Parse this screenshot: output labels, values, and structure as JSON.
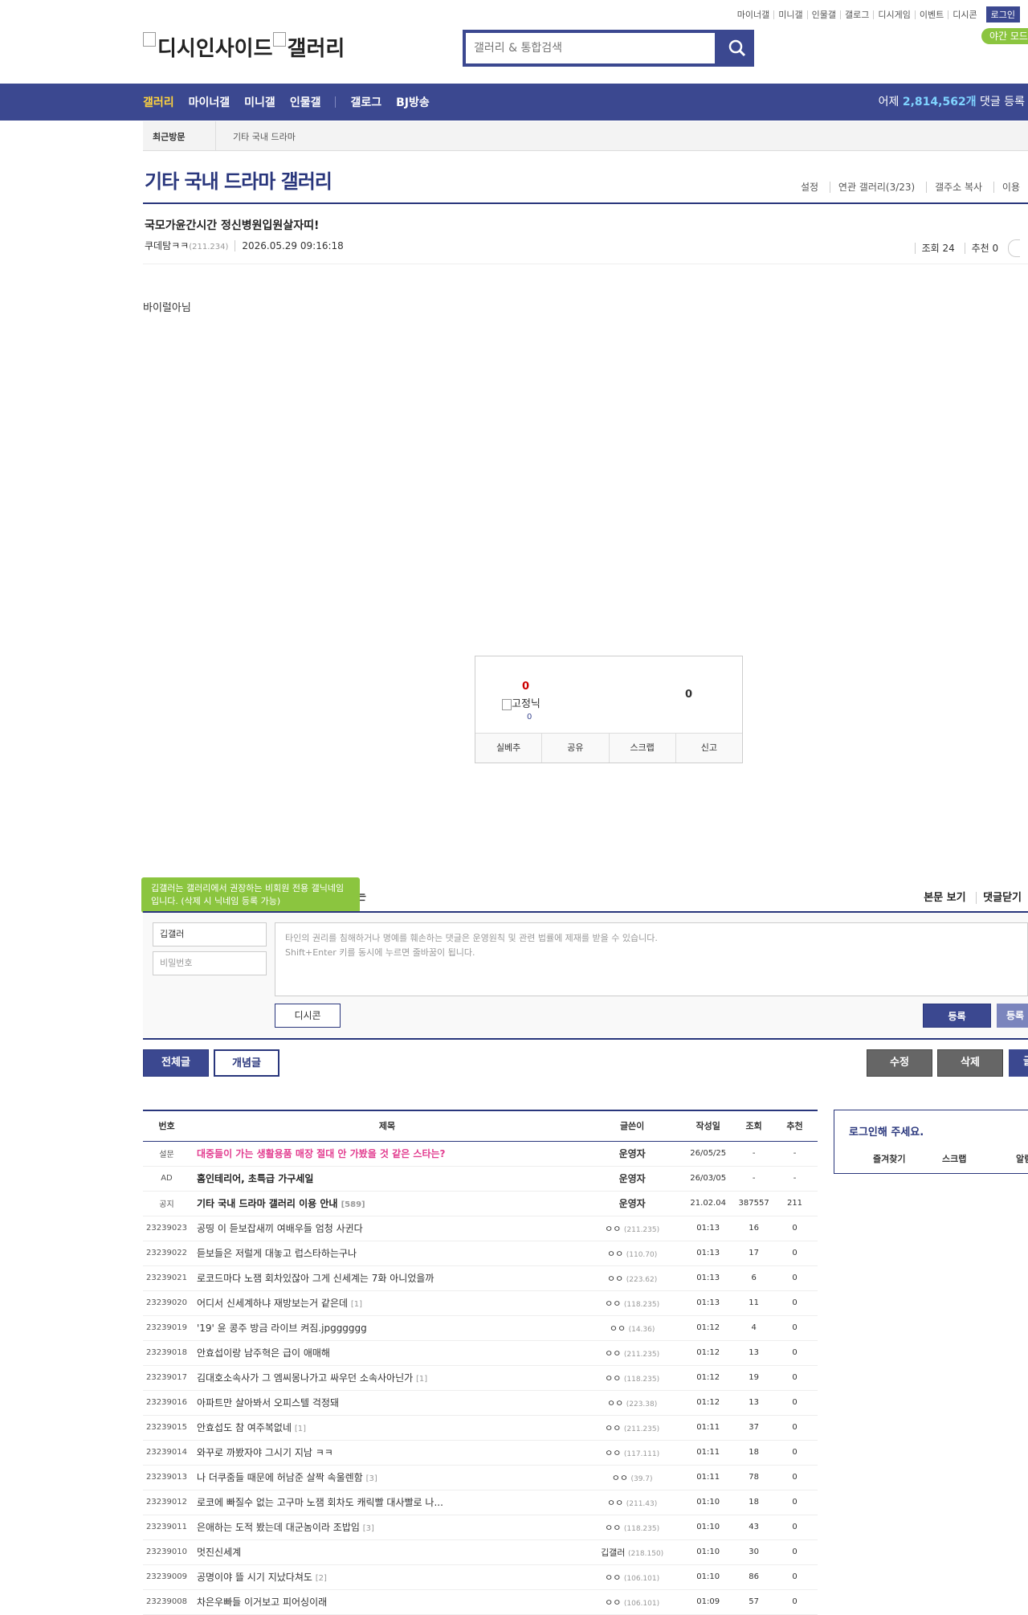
{
  "header": {
    "top_links": [
      "마이너갤",
      "미니갤",
      "인물갤",
      "갤로그",
      "디시게임",
      "이벤트",
      "디시콘"
    ],
    "login_label": "로그인",
    "night_mode_label": "야간 모드",
    "logo_text": "디시인사이드",
    "logo_sub": "갤러리",
    "search_placeholder": "갤러리 & 통합검색"
  },
  "gnb": {
    "menu": [
      "갤러리",
      "마이너갤",
      "미니갤",
      "인물갤",
      "갤로그",
      "BJ방송"
    ],
    "stat_prefix": "어제 ",
    "stat_count": "2,814,562개",
    "stat_suffix": " 댓글 등록"
  },
  "recent": {
    "label": "최근방문",
    "value": "기타 국내 드라마"
  },
  "gallery": {
    "title": "기타 국내 드라마 갤러리",
    "tools": [
      "설정",
      "연관 갤러리(3/23)",
      "갤주소 복사",
      "이용"
    ]
  },
  "post": {
    "title": "국모가윤간시간 정신병원입원살자띠!",
    "writer": "쿠데탐ㅋㅋ",
    "writer_ip": "(211.234)",
    "date": "2026.05.29 09:16:18",
    "views": "조회 24",
    "recommend": "추천 0",
    "body": "바이럴아님"
  },
  "vote": {
    "up_count": "0",
    "fix_label": "고정닉",
    "fix_count": "0",
    "down_count": "0",
    "buttons": [
      "실베추",
      "공유",
      "스크랩",
      "신고"
    ]
  },
  "comment": {
    "tooltip": "깁갤러는 갤러리에서 권장하는 비회원 전용 갤닉네임입니다. (삭제 시 닉네임 등록 가능)",
    "header_tail": "는",
    "right_links": [
      "본문 보기",
      "댓글닫기"
    ],
    "name_value": "깁갤러",
    "pw_placeholder": "비밀번호",
    "text_line1": "타인의 권리를 침해하거나 명예를 훼손하는 댓글은 운영원칙 및 관련 법률에 제재를 받을 수 있습니다.",
    "text_line2": "Shift+Enter 키를 동시에 누르면 줄바꿈이 됩니다.",
    "dccon_label": "디시콘",
    "submit_label": "등록",
    "submit2_label": "등록"
  },
  "list_actions": {
    "tab_all": "전체글",
    "tab_concept": "개념글",
    "edit": "수정",
    "delete": "삭제",
    "write": "글"
  },
  "table": {
    "headers": [
      "번호",
      "제목",
      "글쓴이",
      "작성일",
      "조회",
      "추천"
    ],
    "rows": [
      {
        "num": "설문",
        "title": "대중들이 가는 생활용품 매장 절대 안 가봤을 것 같은 스타는?",
        "cnt": "",
        "writer": "운영자",
        "ip": "",
        "date": "26/05/25",
        "views": "-",
        "rec": "-",
        "style": "hl",
        "admin": true
      },
      {
        "num": "AD",
        "title": "홈인테리어, 초특급 가구세일",
        "cnt": "",
        "writer": "운영자",
        "ip": "",
        "date": "26/03/05",
        "views": "-",
        "rec": "-",
        "style": "bold",
        "admin": true
      },
      {
        "num": "공지",
        "title": "기타 국내 드라마 갤러리 이용 안내",
        "cnt": "[589]",
        "writer": "운영자",
        "ip": "",
        "date": "21.02.04",
        "views": "387557",
        "rec": "211",
        "style": "bold",
        "admin": true
      },
      {
        "num": "23239023",
        "title": "공띵 이 듣보잡새끼 여배우들 엄청 사귄다",
        "cnt": "",
        "writer": "ㅇㅇ",
        "ip": "(211.235)",
        "date": "01:13",
        "views": "16",
        "rec": "0",
        "style": "",
        "admin": false
      },
      {
        "num": "23239022",
        "title": "듣보들은 저럴게 대놓고 럽스타하는구나",
        "cnt": "",
        "writer": "ㅇㅇ",
        "ip": "(110.70)",
        "date": "01:13",
        "views": "17",
        "rec": "0",
        "style": "",
        "admin": false
      },
      {
        "num": "23239021",
        "title": "로코드마다 노잼 회차있잖아 그게 신세계는 7화 아니었을까",
        "cnt": "",
        "writer": "ㅇㅇ",
        "ip": "(223.62)",
        "date": "01:13",
        "views": "6",
        "rec": "0",
        "style": "",
        "admin": false
      },
      {
        "num": "23239020",
        "title": "어디서 신세계하냐 재방보는거 같은데",
        "cnt": "[1]",
        "writer": "ㅇㅇ",
        "ip": "(118.235)",
        "date": "01:13",
        "views": "11",
        "rec": "0",
        "style": "",
        "admin": false
      },
      {
        "num": "23239019",
        "title": "'19' 윤 콩주 방금 라이브 켜짐.jpgggggg",
        "cnt": "",
        "writer": "ㅇㅇ",
        "ip": "(14.36)",
        "date": "01:12",
        "views": "4",
        "rec": "0",
        "style": "",
        "admin": false
      },
      {
        "num": "23239018",
        "title": "안효섭이랑 남주혁은 급이 애매해",
        "cnt": "",
        "writer": "ㅇㅇ",
        "ip": "(211.235)",
        "date": "01:12",
        "views": "13",
        "rec": "0",
        "style": "",
        "admin": false
      },
      {
        "num": "23239017",
        "title": "김대호소속사가 그 엠씨몽나가고 싸우던 소속사아닌가",
        "cnt": "[1]",
        "writer": "ㅇㅇ",
        "ip": "(118.235)",
        "date": "01:12",
        "views": "19",
        "rec": "0",
        "style": "",
        "admin": false
      },
      {
        "num": "23239016",
        "title": "아파트만 살아봐서 오피스텔 걱정돼",
        "cnt": "",
        "writer": "ㅇㅇ",
        "ip": "(223.38)",
        "date": "01:12",
        "views": "13",
        "rec": "0",
        "style": "",
        "admin": false
      },
      {
        "num": "23239015",
        "title": "안효섭도 참 여주복없네",
        "cnt": "[1]",
        "writer": "ㅇㅇ",
        "ip": "(211.235)",
        "date": "01:11",
        "views": "37",
        "rec": "0",
        "style": "",
        "admin": false
      },
      {
        "num": "23239014",
        "title": "와꾸로 까봤자야 그시기 지남 ㅋㅋ",
        "cnt": "",
        "writer": "ㅇㅇ",
        "ip": "(117.111)",
        "date": "01:11",
        "views": "18",
        "rec": "0",
        "style": "",
        "admin": false
      },
      {
        "num": "23239013",
        "title": "나 더쿠줌들 때문에 허남준 살짝 속울렌함",
        "cnt": "[3]",
        "writer": "ㅇㅇ",
        "ip": "(39.7)",
        "date": "01:11",
        "views": "78",
        "rec": "0",
        "style": "",
        "admin": false
      },
      {
        "num": "23239012",
        "title": "로코에 빠질수 없는 고구마 노잼 회차도 캐릭빨 대사빨로 나...",
        "cnt": "",
        "writer": "ㅇㅇ",
        "ip": "(211.43)",
        "date": "01:10",
        "views": "18",
        "rec": "0",
        "style": "",
        "admin": false
      },
      {
        "num": "23239011",
        "title": "은애하는 도적 봤는데 대군놈이라 조밥임",
        "cnt": "[3]",
        "writer": "ㅇㅇ",
        "ip": "(118.235)",
        "date": "01:10",
        "views": "43",
        "rec": "0",
        "style": "",
        "admin": false
      },
      {
        "num": "23239010",
        "title": "멋진신세계",
        "cnt": "",
        "writer": "깁갤러",
        "ip": "(218.150)",
        "date": "01:10",
        "views": "30",
        "rec": "0",
        "style": "",
        "admin": false
      },
      {
        "num": "23239009",
        "title": "공명이야 뜰 시기 지났다쳐도",
        "cnt": "[2]",
        "writer": "ㅇㅇ",
        "ip": "(106.101)",
        "date": "01:10",
        "views": "86",
        "rec": "0",
        "style": "",
        "admin": false
      },
      {
        "num": "23239008",
        "title": "차은우빠들 이거보고 피어싱이래",
        "cnt": "",
        "writer": "ㅇㅇ",
        "ip": "(106.101)",
        "date": "01:09",
        "views": "57",
        "rec": "0",
        "style": "",
        "admin": false
      }
    ]
  },
  "side": {
    "login_msg": "로그인해 주세요.",
    "links": [
      "즐겨찾기",
      "스크랩",
      "알림"
    ]
  },
  "colors": {
    "primary": "#3b4890",
    "dark": "#29367c",
    "accent_green": "#8bc53f",
    "highlight_pink": "#e23c8f"
  }
}
